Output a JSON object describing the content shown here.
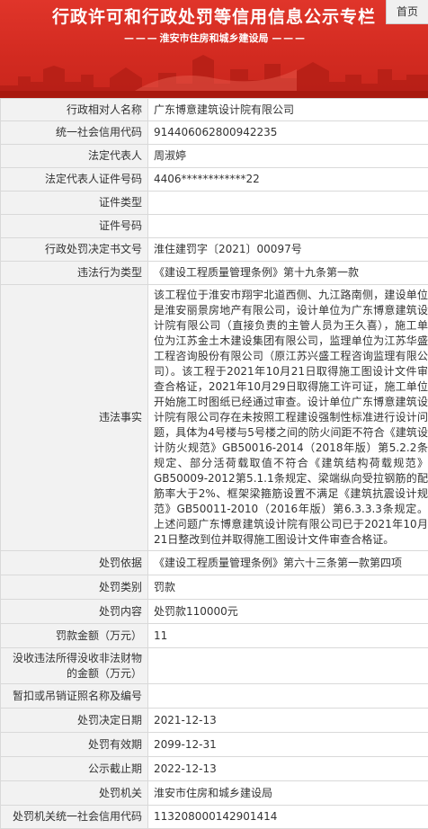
{
  "header": {
    "title": "行政许可和行政处罚等信用信息公示专栏",
    "subtitle": "淮安市住房和城乡建设局",
    "home_label": "首页",
    "colors": {
      "banner": "#d22a20",
      "label_bg": "#f2f2f2",
      "border": "#d9d9d9"
    }
  },
  "rows": [
    {
      "label": "行政相对人名称",
      "value": "广东博意建筑设计院有限公司"
    },
    {
      "label": "统一社会信用代码",
      "value": "914406062800942235"
    },
    {
      "label": "法定代表人",
      "value": "周淑婷"
    },
    {
      "label": "法定代表人证件号码",
      "value": "4406************22"
    },
    {
      "label": "证件类型",
      "value": ""
    },
    {
      "label": "证件号码",
      "value": ""
    },
    {
      "label": "行政处罚决定书文号",
      "value": "淮住建罚字〔2021〕00097号"
    },
    {
      "label": "违法行为类型",
      "value": "《建设工程质量管理条例》第十九条第一款"
    },
    {
      "label": "违法事实",
      "value": "该工程位于淮安市翔宇北道西侧、九江路南侧，建设单位是淮安丽景房地产有限公司，设计单位为广东博意建筑设计院有限公司（直接负责的主管人员为王久喜），施工单位为江苏金土木建设集团有限公司，监理单位为江苏华盛工程咨询股份有限公司（原江苏兴盛工程咨询监理有限公司）。该工程于2021年10月21日取得施工图设计文件审查合格证，2021年10月29日取得施工许可证，施工单位开始施工时图纸已经通过审查。设计单位广东博意建筑设计院有限公司存在未按照工程建设强制性标准进行设计问题，具体为4号楼与5号楼之间的防火间距不符合《建筑设计防火规范》GB50016-2014（2018年版）第5.2.2条规定、部分活荷载取值不符合《建筑结构荷载规范》GB50009-2012第5.1.1条规定、梁端纵向受拉钢筋的配筋率大于2%、框架梁箍筋设置不满足《建筑抗震设计规范》GB50011-2010（2016年版）第6.3.3.3条规定。上述问题广东博意建筑设计院有限公司已于2021年10月21日整改到位并取得施工图设计文件审查合格证。"
    },
    {
      "label": "处罚依据",
      "value": "《建设工程质量管理条例》第六十三条第一款第四项"
    },
    {
      "label": "处罚类别",
      "value": "罚款"
    },
    {
      "label": "处罚内容",
      "value": "处罚款110000元"
    },
    {
      "label": "罚款金额（万元）",
      "value": "11"
    },
    {
      "label": "没收违法所得没收非法财物的金额（万元）",
      "value": ""
    },
    {
      "label": "暂扣或吊销证照名称及编号",
      "value": ""
    },
    {
      "label": "处罚决定日期",
      "value": "2021-12-13"
    },
    {
      "label": "处罚有效期",
      "value": "2099-12-31"
    },
    {
      "label": "公示截止期",
      "value": "2022-12-13"
    },
    {
      "label": "处罚机关",
      "value": "淮安市住房和城乡建设局"
    },
    {
      "label": "处罚机关统一社会信用代码",
      "value": "113208000142901414"
    }
  ]
}
